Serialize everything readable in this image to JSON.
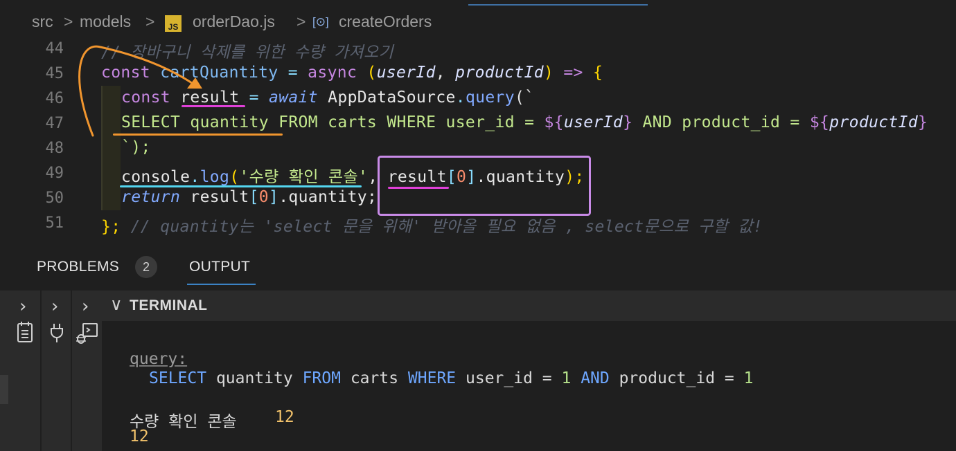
{
  "breadcrumb": {
    "parts": [
      "src",
      "models",
      "orderDao.js",
      "createOrders"
    ],
    "separator": ">",
    "file_icon_text": "JS",
    "method_icon_text": "[⊙]"
  },
  "editor": {
    "line_numbers": [
      "44",
      "45",
      "46",
      "47",
      "48",
      "49",
      "50",
      "51"
    ],
    "l44": "// 장바구니 삭제를 위한 수량 가져오기",
    "l45": {
      "kw": "const",
      "name": "cartQuantity",
      "eq": " = ",
      "async": "async",
      "open": " (",
      "p1": "userId",
      "comma": ", ",
      "p2": "productId",
      "close": ") ",
      "arrow": "=>",
      "brace": " {"
    },
    "l46": {
      "kw": "const",
      "var": "result",
      "eq": " = ",
      "await": "await",
      "obj": " AppDataSource",
      "dot": ".",
      "method": "query",
      "tail": "(`"
    },
    "l47": {
      "sql1": "SELECT quantity FROM carts WHERE user_id = ",
      "d1": "${",
      "v1": "userId",
      "e1": "}",
      "sql2": " AND product_id = ",
      "d2": "${",
      "v2": "productId",
      "e2": "}"
    },
    "l48": "`);",
    "l49": {
      "obj": "console",
      "dot": ".",
      "method": "log",
      "open": "(",
      "str": "'수량 확인 콘솔'",
      "comma": ", ",
      "var": "result",
      "b1": "[",
      "idx": "0",
      "b2": "]",
      "prop": ".quantity",
      "close": ");"
    },
    "l50": {
      "kw": "return",
      "var": " result",
      "b1": "[",
      "idx": "0",
      "b2": "]",
      "prop": ".quantity;"
    },
    "l51": {
      "end": "};",
      "comment": " // quantity는 'select 문을 위해' 받아올 필요 없음 , select문으로 구할 값!"
    }
  },
  "panel": {
    "tabs": [
      {
        "label": "PROBLEMS",
        "badge": "2"
      },
      {
        "label": "OUTPUT"
      }
    ],
    "active_tab": "OUTPUT"
  },
  "terminal": {
    "title": "TERMINAL",
    "query_label": "query:",
    "sql": {
      "select": "SELECT",
      "t1": " quantity ",
      "from": "FROM",
      "t2": " carts ",
      "where": "WHERE",
      "t3": " user_id = ",
      "n1": "1",
      "and": " AND",
      "t4": " product_id = ",
      "n2": "1"
    },
    "log_label": "수량 확인 콘솔",
    "log_value": "12",
    "return_value": "12"
  },
  "colors": {
    "annotation_orange": "#f0952e",
    "annotation_magenta": "#e040d8",
    "annotation_cyan": "#54d6f0",
    "annotation_box": "#c98be8"
  }
}
